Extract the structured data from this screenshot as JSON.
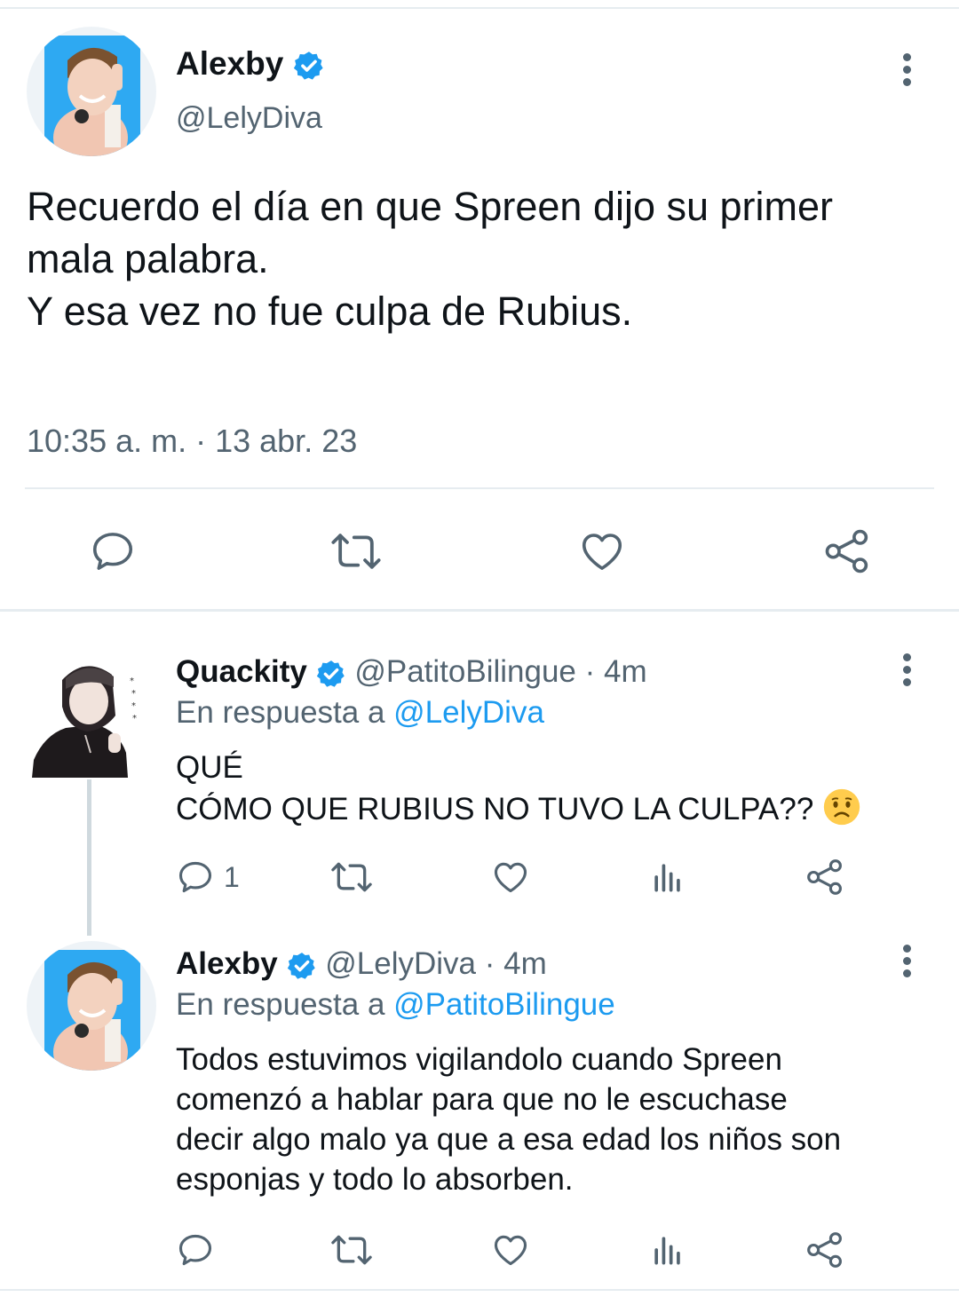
{
  "main_tweet": {
    "display_name": "Alexby",
    "handle": "@LelyDiva",
    "text": "Recuerdo el día en que Spreen dijo su primer\nmala palabra.\nY esa vez no fue culpa de Rubius.",
    "timestamp": "10:35 a. m. · 13 abr. 23",
    "actions": [
      "reply-icon",
      "retweet-icon",
      "like-icon",
      "share-icon"
    ]
  },
  "replies": [
    {
      "display_name": "Quackity",
      "handle": "@PatitoBilingue",
      "time": " · 4m",
      "reply_prefix": "En respuesta a ",
      "reply_to": "@LelyDiva",
      "text_line1": "QUÉ",
      "text_line2": "CÓMO QUE RUBIUS NO TUVO LA CULPA?? ",
      "emoji": "worried-face-emoji",
      "reply_count": "1"
    },
    {
      "display_name": "Alexby",
      "handle": "@LelyDiva",
      "time": " · 4m",
      "reply_prefix": "En respuesta a ",
      "reply_to": "@PatitoBilingue",
      "text": "Todos estuvimos vigilandolo cuando Spreen\ncomenzó a hablar para que no le escuchase\ndecir algo malo ya que a esa edad los niños son\nesponjas y todo lo absorben."
    }
  ],
  "colors": {
    "accent": "#1d9bf0",
    "muted": "#536471",
    "separator": "#e6ecf0"
  }
}
